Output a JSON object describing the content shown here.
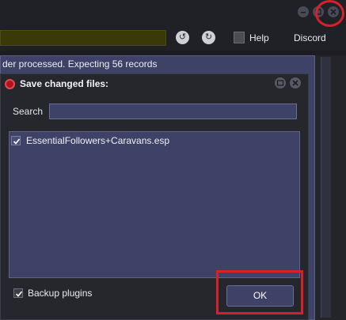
{
  "toolbar": {
    "help_label": "Help",
    "discord_label": "Discord"
  },
  "log": {
    "line1": "der processed. Expecting 56 records"
  },
  "dialog": {
    "title": "Save changed files:",
    "search_label": "Search",
    "search_value": "",
    "files": [
      {
        "name": "EssentialFollowers+Caravans.esp",
        "checked": true
      }
    ],
    "backup_label": "Backup plugins",
    "backup_checked": true,
    "ok_label": "OK"
  },
  "colors": {
    "accent_panel": "#3e4266",
    "highlight": "#d8202a",
    "dialog_bg": "#26262d"
  }
}
